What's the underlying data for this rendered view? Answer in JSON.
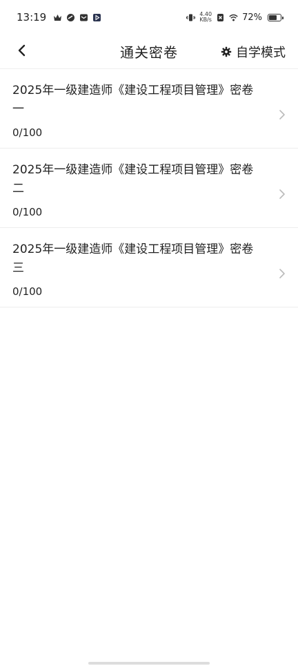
{
  "status_bar": {
    "time": "13:19",
    "net_speed_value": "4.40",
    "net_speed_unit": "KB/s",
    "battery_percent": "72%",
    "battery_level": 0.72,
    "icons": [
      "crown-icon",
      "app-icon",
      "mail-icon",
      "play-icon",
      "vibrate-icon",
      "no-sim-icon",
      "wifi-icon",
      "battery-icon"
    ]
  },
  "header": {
    "title": "通关密卷",
    "back_icon": "chevron-left-icon",
    "self_study_label": "自学模式",
    "self_study_icon": "gear-icon"
  },
  "exams": [
    {
      "title": "2025年一级建造师《建设工程项目管理》密卷一",
      "score": "0/100"
    },
    {
      "title": "2025年一级建造师《建设工程项目管理》密卷二",
      "score": "0/100"
    },
    {
      "title": "2025年一级建造师《建设工程项目管理》密卷三",
      "score": "0/100"
    }
  ]
}
